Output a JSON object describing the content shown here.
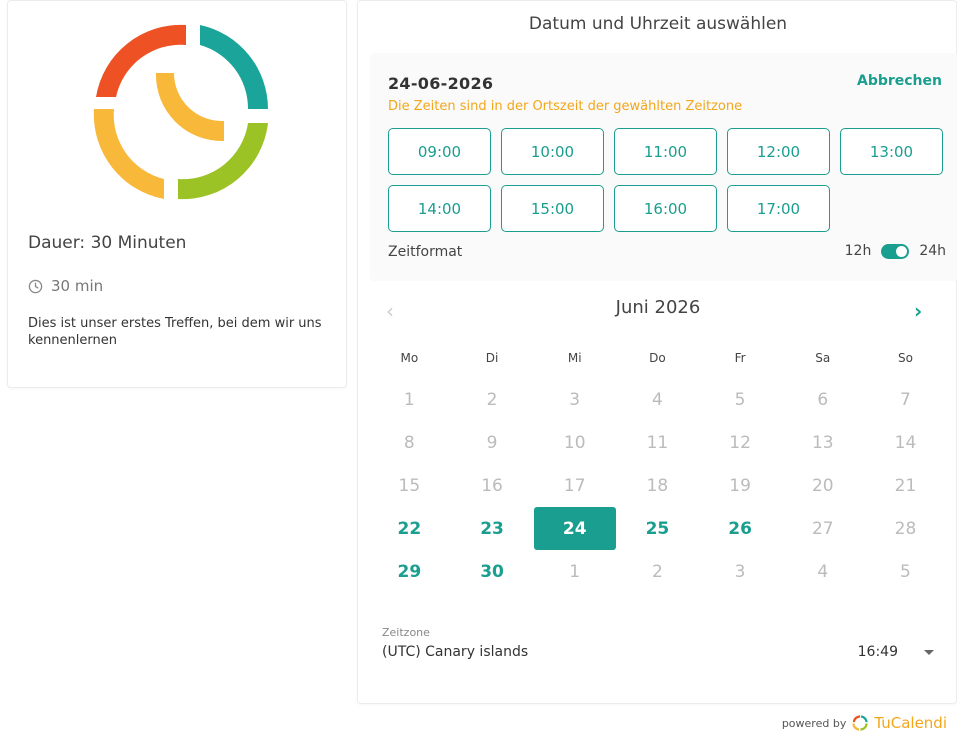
{
  "event": {
    "duration_title": "Dauer: 30 Minuten",
    "duration_short": "30 min",
    "description": "Dies ist unser erstes Treffen, bei dem wir uns kennenlernen"
  },
  "header": {
    "title": "Datum und Uhrzeit auswählen"
  },
  "times": {
    "selected_date": "24-06-2026",
    "cancel_label": "Abbrechen",
    "timezone_note": "Die Zeiten sind in der Ortszeit der gewählten Zeitzone",
    "slots": [
      "09:00",
      "10:00",
      "11:00",
      "12:00",
      "13:00",
      "14:00",
      "15:00",
      "16:00",
      "17:00"
    ],
    "format_label": "Zeitformat",
    "format_12h": "12h",
    "format_24h": "24h",
    "format_selected": "24h"
  },
  "calendar": {
    "month_label": "Juni 2026",
    "prev_icon": "chevron-left-icon",
    "next_icon": "chevron-right-icon",
    "weekdays": [
      "Mo",
      "Di",
      "Mi",
      "Do",
      "Fr",
      "Sa",
      "So"
    ],
    "days": [
      {
        "label": "1",
        "state": "disabled"
      },
      {
        "label": "2",
        "state": "disabled"
      },
      {
        "label": "3",
        "state": "disabled"
      },
      {
        "label": "4",
        "state": "disabled"
      },
      {
        "label": "5",
        "state": "disabled"
      },
      {
        "label": "6",
        "state": "disabled"
      },
      {
        "label": "7",
        "state": "disabled"
      },
      {
        "label": "8",
        "state": "disabled"
      },
      {
        "label": "9",
        "state": "disabled"
      },
      {
        "label": "10",
        "state": "disabled"
      },
      {
        "label": "11",
        "state": "disabled"
      },
      {
        "label": "12",
        "state": "disabled"
      },
      {
        "label": "13",
        "state": "disabled"
      },
      {
        "label": "14",
        "state": "disabled"
      },
      {
        "label": "15",
        "state": "disabled"
      },
      {
        "label": "16",
        "state": "disabled"
      },
      {
        "label": "17",
        "state": "disabled"
      },
      {
        "label": "18",
        "state": "disabled"
      },
      {
        "label": "19",
        "state": "disabled"
      },
      {
        "label": "20",
        "state": "disabled"
      },
      {
        "label": "21",
        "state": "disabled"
      },
      {
        "label": "22",
        "state": "available"
      },
      {
        "label": "23",
        "state": "available"
      },
      {
        "label": "24",
        "state": "selected"
      },
      {
        "label": "25",
        "state": "available"
      },
      {
        "label": "26",
        "state": "available"
      },
      {
        "label": "27",
        "state": "disabled"
      },
      {
        "label": "28",
        "state": "disabled"
      },
      {
        "label": "29",
        "state": "available"
      },
      {
        "label": "30",
        "state": "available"
      },
      {
        "label": "1",
        "state": "disabled"
      },
      {
        "label": "2",
        "state": "disabled"
      },
      {
        "label": "3",
        "state": "disabled"
      },
      {
        "label": "4",
        "state": "disabled"
      },
      {
        "label": "5",
        "state": "disabled"
      }
    ]
  },
  "timezone": {
    "label": "Zeitzone",
    "value": "(UTC) Canary islands",
    "current_time": "16:49"
  },
  "footer": {
    "powered_by": "powered by",
    "brand_tu": "Tu",
    "brand_calendi": "Calendi"
  },
  "colors": {
    "accent": "#1a9e8f",
    "warning": "#f2a71b",
    "logo_red": "#ee5123",
    "logo_teal": "#1ba59a",
    "logo_yellow": "#f8b83a",
    "logo_green": "#9bc325"
  }
}
